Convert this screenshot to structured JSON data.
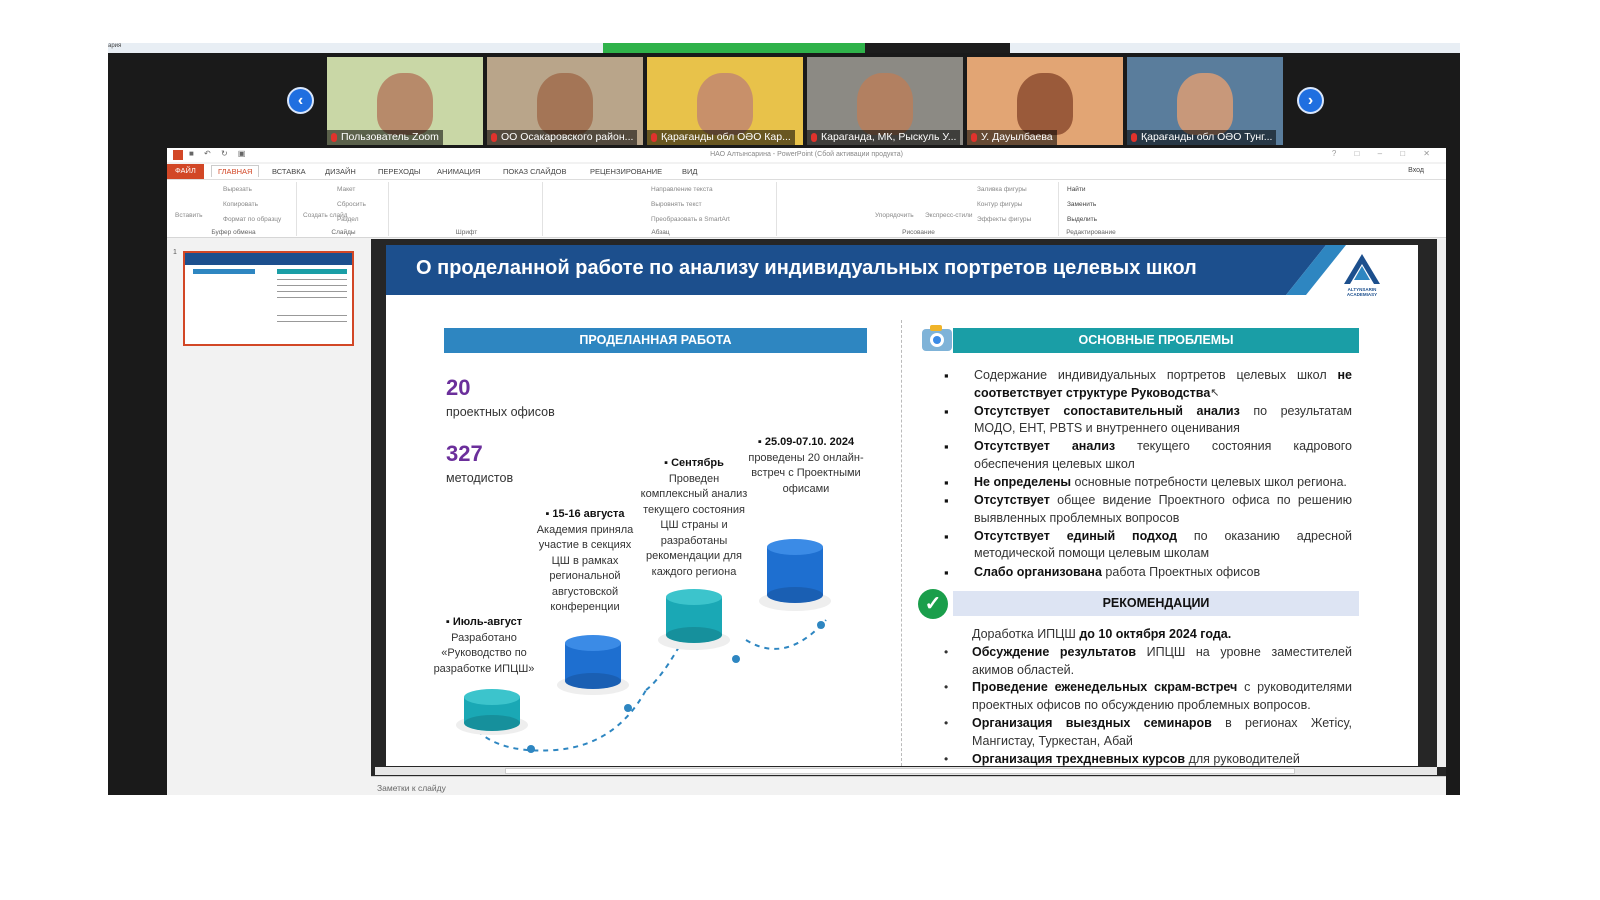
{
  "meeting": {
    "corner_label": "ария",
    "participants": [
      {
        "name": "Пользователь Zoom",
        "bg": "#c9d7a6",
        "skin": "#b78a6a"
      },
      {
        "name": "ОО Осакаровского район...",
        "bg": "#b9a58a",
        "skin": "#a47556"
      },
      {
        "name": "Қарағанды обл ОӘО Кар...",
        "bg": "#e8c24a",
        "skin": "#c8906a"
      },
      {
        "name": "Караганда, МК, Рыскуль У...",
        "bg": "#8c8a84",
        "skin": "#b28061"
      },
      {
        "name": "У. Дауылбаева",
        "bg": "#e2a574",
        "skin": "#9a5a3a"
      },
      {
        "name": "Қарағанды обл ОӘО Тунг...",
        "bg": "#5a7d9c",
        "skin": "#c8987a"
      }
    ]
  },
  "ppt": {
    "window_title": "НАО Алтынсарина - PowerPoint (Сбой активации продукта)",
    "signin": "Вход",
    "tabs": [
      "ФАЙЛ",
      "ГЛАВНАЯ",
      "ВСТАВКА",
      "ДИЗАЙН",
      "ПЕРЕХОДЫ",
      "АНИМАЦИЯ",
      "ПОКАЗ СЛАЙДОВ",
      "РЕЦЕНЗИРОВАНИЕ",
      "ВИД"
    ],
    "ribbon": {
      "paste": "Вставить",
      "cut": "Вырезать",
      "copy": "Копировать",
      "format_painter": "Формат по образцу",
      "clipboard": "Буфер обмена",
      "new_slide": "Создать слайд",
      "layout": "Макет",
      "reset": "Сбросить",
      "section": "Раздел",
      "slides": "Слайды",
      "font": "Шрифт",
      "text_direction": "Направление текста",
      "align_text": "Выровнять текст",
      "smartart": "Преобразовать в SmartArt",
      "paragraph": "Абзац",
      "arrange": "Упорядочить",
      "quick_styles": "Экспресс-стили",
      "shape_fill": "Заливка фигуры",
      "shape_outline": "Контур фигуры",
      "shape_effects": "Эффекты фигуры",
      "drawing": "Рисование",
      "find": "Найти",
      "replace": "Заменить",
      "select": "Выделить",
      "editing": "Редактирование"
    },
    "slide_number": "1",
    "notes_label": "Заметки к слайду"
  },
  "slide": {
    "title": "О проделанной работе по анализу индивидуальных портретов целевых школ",
    "logo_text": "ALTYNSARIN ACADEMIASY",
    "left_header": "ПРОДЕЛАННАЯ РАБОТА",
    "stat1_value": "20",
    "stat1_label": "проектных офисов",
    "stat2_value": "327",
    "stat2_label": "методистов",
    "timeline": [
      {
        "date": "Июль-август",
        "text": "Разработано «Руководство по разработке ИПЦШ»"
      },
      {
        "date": "15-16 августа",
        "text": "Академия приняла участие в секциях ЦШ в рамках региональной августовской конференции"
      },
      {
        "date": "Сентябрь",
        "text": "Проведен комплексный анализ текущего состояния ЦШ страны и разработаны рекомендации для каждого региона"
      },
      {
        "date": "25.09-07.10. 2024",
        "text": "проведены 20 онлайн-встреч с Проектными офисами"
      }
    ],
    "problems_header": "ОСНОВНЫЕ ПРОБЛЕМЫ",
    "problems": [
      {
        "a": "",
        "b": "",
        "c": "Содержание индивидуальных портретов целевых школ ",
        "d": "не соответствует структуре Руководства"
      },
      {
        "a": "",
        "b": "Отсутствует сопоставительный анализ",
        "c": " по результатам МОДО, ЕНТ, PBTS и внутреннего оценивания",
        "d": ""
      },
      {
        "a": "",
        "b": "Отсутствует анализ",
        "c": " текущего состояния кадрового обеспечения целевых школ",
        "d": ""
      },
      {
        "a": "",
        "b": "Не определены",
        "c": " основные потребности целевых школ региона.",
        "d": ""
      },
      {
        "a": "",
        "b": "Отсутствует",
        "c": " общее видение Проектного офиса по решению выявленных проблемных вопросов",
        "d": ""
      },
      {
        "a": "",
        "b": "Отсутствует единый подход",
        "c": " по оказанию адресной методической помощи целевым школам",
        "d": ""
      },
      {
        "a": "",
        "b": "Слабо организована",
        "c": " работа Проектных офисов",
        "d": ""
      }
    ],
    "rec_header": "РЕКОМЕНДАЦИИ",
    "recommendations": [
      {
        "pre": "Доработка ИПЦШ ",
        "b": "до 10 октября 2024 года.",
        "post": ""
      },
      {
        "pre": "",
        "b": "Обсуждение результатов",
        "post": " ИПЦШ на уровне заместителей акимов областей."
      },
      {
        "pre": "",
        "b": "Проведение еженедельных скрам-встреч",
        "post": " с руководителями проектных офисов по обсуждению проблемных вопросов."
      },
      {
        "pre": "",
        "b": "Организация выездных семинаров",
        "post": " в регионах Жетісу, Мангистау, Туркестан, Абай"
      },
      {
        "pre": "",
        "b": "Организация трехдневных курсов",
        "post": " для руководителей"
      }
    ]
  },
  "colors": {
    "title_bar": "#1c4f8d",
    "left_header": "#2e86c1",
    "problems_header": "#1a9ea6",
    "rec_header": "#dde4f3",
    "stat_number": "#6b2f9b",
    "zoom_blue": "#1f6fe0",
    "ppt_accent": "#d24726"
  },
  "icons": {
    "prev": "chevron-left-icon",
    "next": "chevron-right-icon",
    "check": "check-circle-icon",
    "camera": "camera-icon"
  }
}
